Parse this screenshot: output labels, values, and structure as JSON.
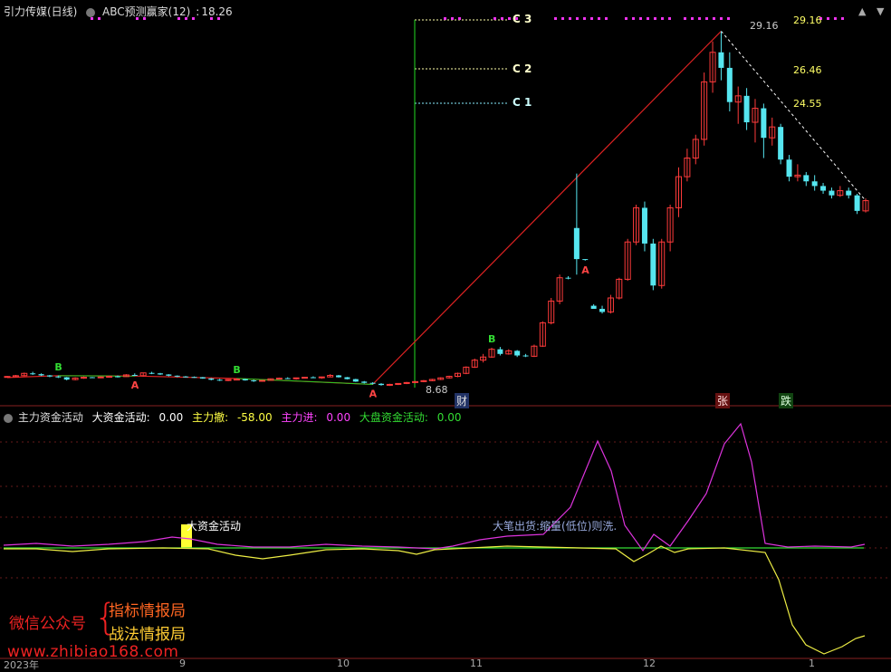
{
  "top_header": {
    "stock_name": "引力传媒(日线)",
    "indicator_name": "ABC预测赢家(12)",
    "indicator_value": "18.26"
  },
  "price_chart": {
    "candles": [
      [
        6.9,
        6.98,
        6.88,
        6.95
      ],
      [
        6.93,
        7.05,
        6.9,
        7.0
      ],
      [
        7.0,
        7.2,
        6.96,
        7.15
      ],
      [
        7.15,
        7.25,
        7.05,
        7.1
      ],
      [
        7.1,
        7.15,
        6.98,
        7.02
      ],
      [
        7.02,
        7.05,
        6.9,
        6.95
      ],
      [
        6.95,
        7.0,
        6.85,
        6.9
      ],
      [
        6.9,
        6.92,
        6.7,
        6.75
      ],
      [
        6.75,
        6.9,
        6.7,
        6.85
      ],
      [
        6.85,
        6.95,
        6.8,
        6.9
      ],
      [
        6.9,
        6.92,
        6.85,
        6.88
      ],
      [
        6.88,
        6.95,
        6.84,
        6.92
      ],
      [
        6.92,
        7.0,
        6.88,
        6.96
      ],
      [
        6.96,
        7.02,
        6.88,
        6.94
      ],
      [
        6.94,
        7.1,
        6.92,
        7.05
      ],
      [
        7.05,
        7.15,
        6.98,
        7.0
      ],
      [
        7.0,
        7.2,
        6.95,
        7.18
      ],
      [
        7.18,
        7.25,
        7.1,
        7.15
      ],
      [
        7.15,
        7.18,
        7.05,
        7.08
      ],
      [
        7.08,
        7.1,
        6.96,
        7.0
      ],
      [
        7.0,
        7.02,
        6.9,
        6.95
      ],
      [
        6.95,
        6.98,
        6.88,
        6.92
      ],
      [
        6.92,
        6.95,
        6.86,
        6.9
      ],
      [
        6.9,
        6.92,
        6.8,
        6.82
      ],
      [
        6.82,
        6.85,
        6.7,
        6.74
      ],
      [
        6.74,
        6.8,
        6.66,
        6.7
      ],
      [
        6.7,
        6.78,
        6.65,
        6.75
      ],
      [
        6.75,
        6.82,
        6.72,
        6.78
      ],
      [
        6.78,
        6.8,
        6.68,
        6.7
      ],
      [
        6.7,
        6.75,
        6.6,
        6.66
      ],
      [
        6.66,
        6.72,
        6.62,
        6.7
      ],
      [
        6.7,
        6.82,
        6.68,
        6.8
      ],
      [
        6.8,
        6.88,
        6.76,
        6.84
      ],
      [
        6.84,
        6.9,
        6.78,
        6.82
      ],
      [
        6.82,
        6.88,
        6.75,
        6.86
      ],
      [
        6.86,
        6.92,
        6.82,
        6.9
      ],
      [
        6.9,
        6.96,
        6.84,
        6.88
      ],
      [
        6.88,
        6.94,
        6.8,
        6.92
      ],
      [
        6.92,
        7.1,
        6.9,
        7.02
      ],
      [
        7.02,
        7.05,
        6.88,
        6.9
      ],
      [
        6.9,
        6.92,
        6.76,
        6.78
      ],
      [
        6.78,
        6.8,
        6.6,
        6.62
      ],
      [
        6.62,
        6.66,
        6.5,
        6.54
      ],
      [
        6.54,
        6.58,
        6.44,
        6.48
      ],
      [
        6.48,
        6.52,
        6.36,
        6.4
      ],
      [
        6.4,
        6.48,
        6.34,
        6.44
      ],
      [
        6.44,
        6.52,
        6.4,
        6.5
      ],
      [
        6.5,
        6.6,
        6.46,
        6.56
      ],
      [
        6.56,
        6.66,
        6.52,
        6.62
      ],
      [
        6.62,
        6.72,
        6.58,
        6.68
      ],
      [
        6.68,
        6.8,
        6.64,
        6.76
      ],
      [
        6.76,
        6.9,
        6.72,
        6.86
      ],
      [
        6.86,
        7.0,
        6.82,
        6.96
      ],
      [
        6.96,
        7.2,
        6.9,
        7.15
      ],
      [
        7.15,
        7.6,
        7.1,
        7.55
      ],
      [
        7.55,
        8.1,
        7.5,
        8.0
      ],
      [
        8.0,
        8.4,
        7.85,
        8.2
      ],
      [
        8.2,
        8.8,
        8.15,
        8.7
      ],
      [
        8.7,
        8.85,
        8.3,
        8.4
      ],
      [
        8.4,
        8.7,
        8.35,
        8.6
      ],
      [
        8.6,
        8.65,
        8.2,
        8.3
      ],
      [
        8.3,
        8.4,
        8.2,
        8.25
      ],
      [
        8.25,
        9.0,
        8.2,
        8.9
      ],
      [
        8.9,
        10.5,
        8.85,
        10.4
      ],
      [
        10.4,
        12.0,
        10.3,
        11.8
      ],
      [
        11.8,
        13.5,
        11.6,
        13.3
      ],
      [
        13.3,
        13.4,
        13.2,
        13.25
      ],
      [
        16.5,
        20.0,
        13.5,
        14.5
      ],
      [
        14.5,
        14.5,
        14.4,
        14.45
      ],
      [
        11.5,
        11.6,
        11.3,
        11.3
      ],
      [
        11.3,
        11.5,
        11.0,
        11.1
      ],
      [
        11.1,
        12.2,
        11.0,
        12.0
      ],
      [
        12.0,
        13.3,
        11.9,
        13.2
      ],
      [
        13.2,
        15.8,
        13.1,
        15.6
      ],
      [
        15.6,
        18.0,
        15.4,
        17.8
      ],
      [
        17.8,
        18.2,
        15.0,
        15.5
      ],
      [
        15.5,
        15.8,
        12.5,
        12.8
      ],
      [
        12.8,
        15.8,
        12.6,
        15.6
      ],
      [
        15.6,
        18.0,
        15.0,
        17.8
      ],
      [
        17.8,
        20.4,
        17.2,
        19.8
      ],
      [
        19.8,
        21.6,
        19.5,
        21.0
      ],
      [
        21.0,
        22.5,
        20.6,
        22.2
      ],
      [
        22.2,
        26.5,
        21.8,
        25.9
      ],
      [
        25.9,
        28.5,
        25.2,
        27.8
      ],
      [
        27.8,
        29.16,
        26.0,
        26.8
      ],
      [
        26.8,
        27.8,
        24.0,
        24.6
      ],
      [
        24.6,
        25.6,
        23.2,
        25.0
      ],
      [
        25.0,
        25.5,
        22.8,
        23.3
      ],
      [
        23.3,
        24.8,
        22.0,
        24.2
      ],
      [
        24.2,
        24.5,
        21.0,
        22.3
      ],
      [
        22.3,
        23.6,
        21.8,
        23.0
      ],
      [
        23.0,
        23.2,
        20.6,
        20.9
      ],
      [
        20.9,
        21.2,
        19.5,
        19.8
      ],
      [
        19.8,
        20.6,
        19.5,
        19.9
      ],
      [
        19.9,
        20.1,
        19.2,
        19.5
      ],
      [
        19.5,
        19.9,
        18.9,
        19.2
      ],
      [
        19.2,
        19.4,
        18.7,
        18.9
      ],
      [
        18.9,
        19.1,
        18.4,
        18.6
      ],
      [
        18.6,
        19.2,
        18.5,
        18.9
      ],
      [
        18.9,
        19.1,
        18.4,
        18.6
      ],
      [
        18.6,
        18.7,
        17.4,
        17.6
      ],
      [
        17.6,
        18.4,
        17.5,
        18.26
      ]
    ],
    "low_label": "8.68",
    "high_label": "29.16",
    "abc_levels": [
      {
        "label": "C 3",
        "value": "29.16"
      },
      {
        "label": "C 2",
        "value": "26.46"
      },
      {
        "label": "C 1",
        "value": "24.55"
      }
    ],
    "signals": [
      {
        "label": "B",
        "color": "#33dd33",
        "i": 6
      },
      {
        "label": "A",
        "color": "#ff4444",
        "i": 15
      },
      {
        "label": "B",
        "color": "#33dd33",
        "i": 27
      },
      {
        "label": "A",
        "color": "#ff4444",
        "i": 43
      },
      {
        "label": "B",
        "color": "#33dd33",
        "i": 57
      },
      {
        "label": "A",
        "color": "#ff4444",
        "i": 68
      }
    ],
    "events": [
      {
        "label": "财",
        "bg": "#223366",
        "color": "#ddd"
      },
      {
        "label": "张",
        "bg": "#661111",
        "color": "#ffdddd"
      },
      {
        "label": "跌",
        "bg": "#114411",
        "color": "#ddffdd"
      }
    ],
    "colors": {
      "up": "#ff3b3b",
      "down": "#56e6f0",
      "zigzag": "#d22",
      "green_line": "#22dd22"
    }
  },
  "sub_header": {
    "title": "主力资金活动",
    "big_label": "大资金活动:",
    "big_value": "0.00",
    "sell_label": "主力撤:",
    "sell_value": "-58.00",
    "buy_label": "主力进:",
    "buy_value": "0.00",
    "market_label": "大盘资金活动:",
    "market_value": "0.00"
  },
  "sub_chart": {
    "annotation_big": "大资金活动",
    "annotation_note": "大笔出货:缩量(低位)则洗."
  },
  "x_axis": {
    "labels": [
      "2023年",
      "9",
      "10",
      "11",
      "12",
      "1"
    ]
  },
  "watermark": {
    "left": "微信公众号",
    "line1": "指标情报局",
    "line2": "战法情报局",
    "site": "www.zhibiao168.com"
  },
  "icons": {
    "collapse": "circle-chevron-icon",
    "scroll_up": "triangle-up-icon",
    "scroll_down": "triangle-down-icon"
  }
}
